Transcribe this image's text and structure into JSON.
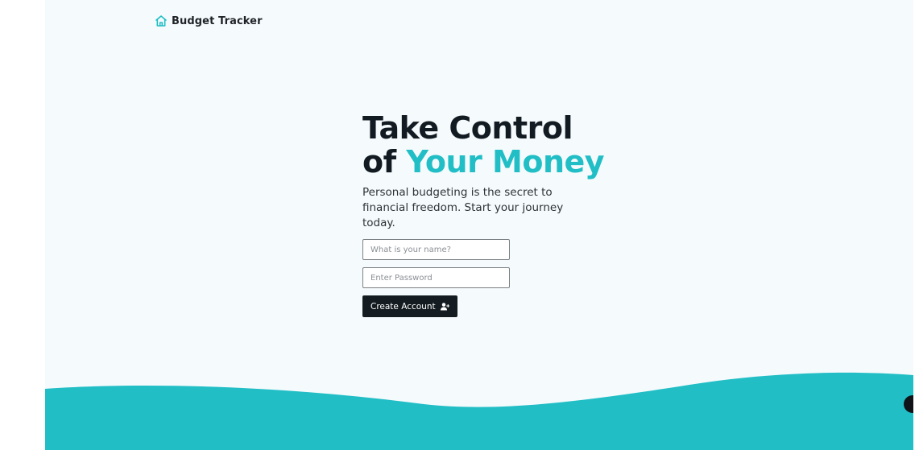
{
  "brand": {
    "name": "Budget Tracker",
    "icon": "home-icon",
    "icon_color": "#21bec6"
  },
  "hero": {
    "title_line1": "Take Control",
    "title_line2_prefix": "of ",
    "title_line2_accent": "Your Money",
    "subtitle": "Personal budgeting is the secret to financial freedom. Start your journey today."
  },
  "form": {
    "name_placeholder": "What is your name?",
    "password_placeholder": "Enter Password",
    "submit_label": "Create Account",
    "submit_icon": "user-plus-icon"
  },
  "colors": {
    "accent": "#21bec6",
    "dark": "#141c22",
    "background": "#f5fafc"
  }
}
